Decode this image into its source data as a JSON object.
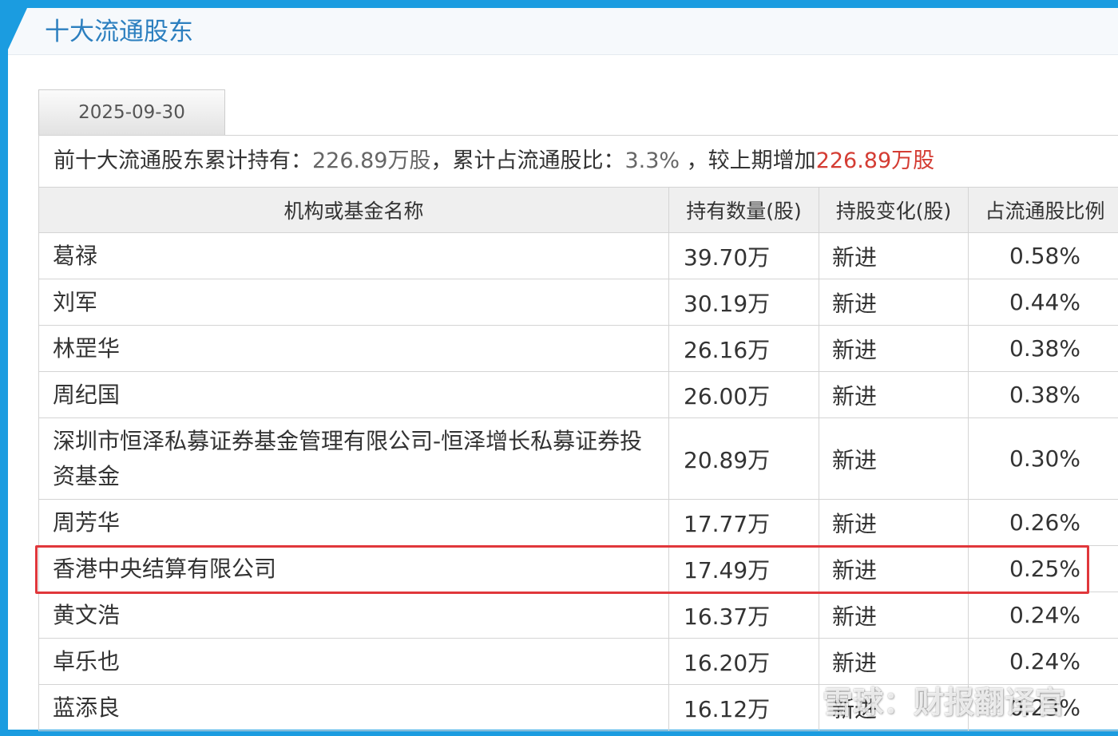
{
  "section": {
    "title": "十大流通股东"
  },
  "tabs": [
    {
      "label": "2025-09-30",
      "active": true
    }
  ],
  "summary": {
    "prefix": "前十大流通股东累计持有：",
    "total_shares": "226.89万股",
    "ratio_label": "，累计占流通股比：",
    "ratio": "3.3%",
    "change_label": " ，较上期增加",
    "change_value": "226.89万股"
  },
  "table": {
    "headers": [
      "机构或基金名称",
      "持有数量(股)",
      "持股变化(股)",
      "占流通股比例"
    ],
    "rows": [
      {
        "name": "葛禄",
        "shares": "39.70万",
        "change": "新进",
        "pct": "0.58%"
      },
      {
        "name": "刘军",
        "shares": "30.19万",
        "change": "新进",
        "pct": "0.44%"
      },
      {
        "name": "林罡华",
        "shares": "26.16万",
        "change": "新进",
        "pct": "0.38%"
      },
      {
        "name": "周纪国",
        "shares": "26.00万",
        "change": "新进",
        "pct": "0.38%"
      },
      {
        "name": "深圳市恒泽私募证券基金管理有限公司-恒泽增长私募证券投资基金",
        "shares": "20.89万",
        "change": "新进",
        "pct": "0.30%"
      },
      {
        "name": "周芳华",
        "shares": "17.77万",
        "change": "新进",
        "pct": "0.26%"
      },
      {
        "name": "香港中央结算有限公司",
        "shares": "17.49万",
        "change": "新进",
        "pct": "0.25%"
      },
      {
        "name": "黄文浩",
        "shares": "16.37万",
        "change": "新进",
        "pct": "0.24%"
      },
      {
        "name": "卓乐也",
        "shares": "16.20万",
        "change": "新进",
        "pct": "0.24%"
      },
      {
        "name": "蓝添良",
        "shares": "16.12万",
        "change": "新进",
        "pct": "0.23%"
      }
    ]
  },
  "highlight": {
    "row_index": 6,
    "color": "#e0373b"
  },
  "watermark": {
    "text": "雪球：财报翻译官",
    "logo_icon": "snowball-logo-icon"
  },
  "colors": {
    "accent": "#1b9ce0",
    "title": "#2c7fbf",
    "increase": "#d43c33",
    "new_entry": "#c00000"
  }
}
